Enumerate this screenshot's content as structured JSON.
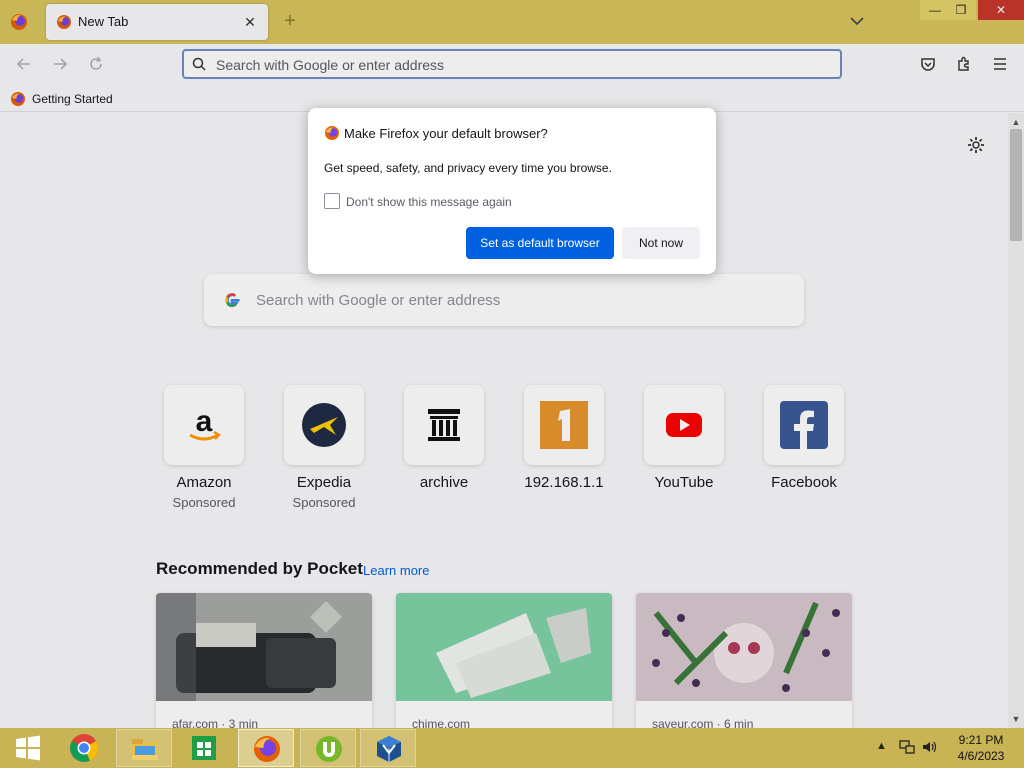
{
  "browser": {
    "tab": {
      "title": "New Tab"
    },
    "window_controls": {
      "minimize": "—",
      "maximize": "❐",
      "close": "✕"
    },
    "urlbar": {
      "placeholder": "Search with Google or enter address"
    },
    "bookmarks": [
      {
        "label": "Getting Started"
      }
    ]
  },
  "newtab": {
    "search": {
      "placeholder": "Search with Google or enter address"
    },
    "top_sites": [
      {
        "name": "Amazon",
        "sponsored": "Sponsored",
        "icon": "amazon-icon"
      },
      {
        "name": "Expedia",
        "sponsored": "Sponsored",
        "icon": "expedia-icon"
      },
      {
        "name": "archive",
        "sponsored": "",
        "icon": "archive-icon"
      },
      {
        "name": "192.168.1.1",
        "sponsored": "",
        "icon": "number-one-icon"
      },
      {
        "name": "YouTube",
        "sponsored": "",
        "icon": "youtube-icon"
      },
      {
        "name": "Facebook",
        "sponsored": "",
        "icon": "facebook-icon"
      }
    ],
    "pocket": {
      "title": "Recommended by Pocket",
      "learn_more": "Learn more",
      "cards": [
        {
          "source": "afar.com · 3 min"
        },
        {
          "source": "chime.com"
        },
        {
          "source": "saveur.com · 6 min"
        }
      ]
    }
  },
  "dialog": {
    "title": "Make Firefox your default browser?",
    "body": "Get speed, safety, and privacy every time you browse.",
    "checkbox_label": "Don't show this message again",
    "primary_button": "Set as default browser",
    "secondary_button": "Not now"
  },
  "taskbar": {
    "clock": {
      "time": "9:21 PM",
      "date": "4/6/2023"
    },
    "apps": [
      "start-icon",
      "chrome-icon",
      "file-explorer-icon",
      "store-icon",
      "firefox-icon",
      "utorrent-icon",
      "virtualbox-icon"
    ]
  },
  "colors": {
    "accent": "#0061e0",
    "titlebar": "#d8c45c",
    "taskbar": "#c9b455"
  }
}
